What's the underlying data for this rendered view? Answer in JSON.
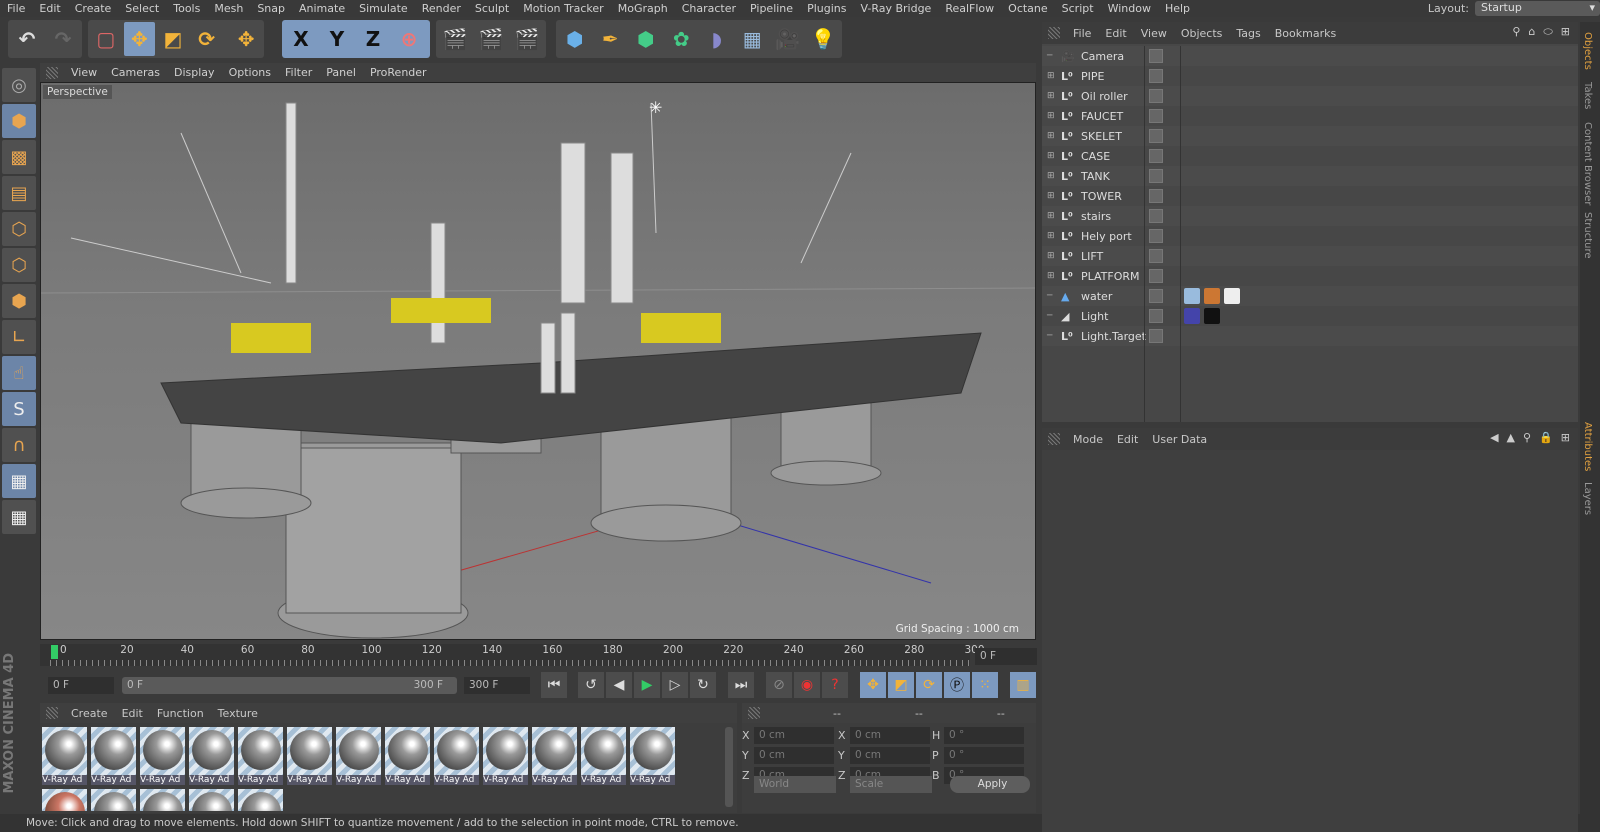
{
  "menu": [
    "File",
    "Edit",
    "Create",
    "Select",
    "Tools",
    "Mesh",
    "Snap",
    "Animate",
    "Simulate",
    "Render",
    "Sculpt",
    "Motion Tracker",
    "MoGraph",
    "Character",
    "Pipeline",
    "Plugins",
    "V-Ray Bridge",
    "RealFlow",
    "Octane",
    "Script",
    "Window",
    "Help"
  ],
  "layout": {
    "label": "Layout:",
    "value": "Startup"
  },
  "axes": {
    "x": "X",
    "y": "Y",
    "z": "Z"
  },
  "viewport": {
    "menu": [
      "View",
      "Cameras",
      "Display",
      "Options",
      "Filter",
      "Panel",
      "ProRender"
    ],
    "label": "Perspective",
    "grid_spacing": "Grid Spacing : 1000 cm"
  },
  "timeline": {
    "ticks": [
      "0",
      "20",
      "40",
      "60",
      "80",
      "100",
      "120",
      "140",
      "160",
      "180",
      "200",
      "220",
      "240",
      "260",
      "280",
      "300"
    ],
    "current_frame": "0 F",
    "start": "0 F",
    "range_start": "0 F",
    "range_end": "300 F",
    "end": "300 F"
  },
  "materials": {
    "menu": [
      "Create",
      "Edit",
      "Function",
      "Texture"
    ],
    "items": [
      "V-Ray Ad",
      "V-Ray Ad",
      "V-Ray Ad",
      "V-Ray Ad",
      "V-Ray Ad",
      "V-Ray Ad",
      "V-Ray Ad",
      "V-Ray Ad",
      "V-Ray Ad",
      "V-Ray Ad",
      "V-Ray Ad",
      "V-Ray Ad",
      "V-Ray Ad"
    ]
  },
  "coords": {
    "headers": [
      "--",
      "--",
      "--"
    ],
    "rows": [
      {
        "a": "X",
        "av": "0 cm",
        "b": "X",
        "bv": "0 cm",
        "c": "H",
        "cv": "0 °"
      },
      {
        "a": "Y",
        "av": "0 cm",
        "b": "Y",
        "bv": "0 cm",
        "c": "P",
        "cv": "0 °"
      },
      {
        "a": "Z",
        "av": "0 cm",
        "b": "Z",
        "bv": "0 cm",
        "c": "B",
        "cv": "0 °"
      }
    ],
    "world": "World",
    "scale": "Scale",
    "apply": "Apply"
  },
  "status": "Move: Click and drag to move elements. Hold down SHIFT to quantize movement / add to the selection in point mode, CTRL to remove.",
  "object_manager": {
    "menu": [
      "File",
      "Edit",
      "View",
      "Objects",
      "Tags",
      "Bookmarks"
    ],
    "objects": [
      "Camera",
      "PIPE",
      "Oil roller",
      "FAUCET",
      "SKELET",
      "CASE",
      "TANK",
      "TOWER",
      "stairs",
      "Hely port",
      "LIFT",
      "PLATFORM",
      "water",
      "Light",
      "Light.Target"
    ]
  },
  "attributes": {
    "menu": [
      "Mode",
      "Edit",
      "User Data"
    ]
  },
  "side_tabs": [
    "Objects",
    "Takes",
    "Content Browser",
    "Structure",
    "Attributes",
    "Layers"
  ],
  "logo": "MAXON CINEMA 4D"
}
